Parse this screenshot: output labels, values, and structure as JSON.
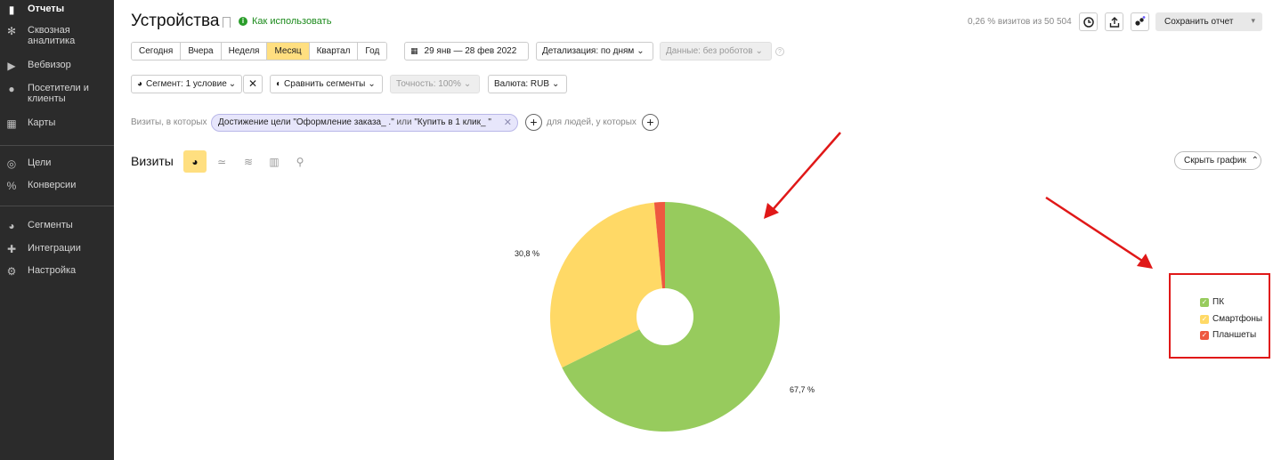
{
  "sidebar": {
    "items": [
      {
        "label": "Отчеты",
        "icon": "bar-chart-icon",
        "active": true
      },
      {
        "label": "Сквозная аналитика",
        "icon": "asterisk-icon"
      },
      {
        "label": "Вебвизор",
        "icon": "play-icon"
      },
      {
        "label": "Посетители и клиенты",
        "icon": "person-icon"
      },
      {
        "label": "Карты",
        "icon": "map-grid-icon"
      },
      {
        "label": "Цели",
        "icon": "target-icon"
      },
      {
        "label": "Конверсии",
        "icon": "percent-icon"
      },
      {
        "label": "Сегменты",
        "icon": "pie-icon"
      },
      {
        "label": "Интеграции",
        "icon": "puzzle-icon"
      },
      {
        "label": "Настройка",
        "icon": "gear-icon"
      }
    ]
  },
  "header": {
    "title": "Устройства",
    "howto": "Как использовать",
    "visits_share": "0,26 % визитов из 50 504",
    "save_report": "Сохранить отчет"
  },
  "periods": {
    "items": [
      "Сегодня",
      "Вчера",
      "Неделя",
      "Месяц",
      "Квартал",
      "Год"
    ],
    "selected": "Месяц",
    "date_range": "29 янв — 28 фев 2022",
    "detail": "Детализация: по дням",
    "data_filter": "Данные: без роботов"
  },
  "segment_row": {
    "segment": "Сегмент: 1 условие",
    "compare": "Сравнить сегменты",
    "accuracy": "Точность: 100%",
    "currency": "Валюта: RUB"
  },
  "filter": {
    "prefix": "Визиты, в которых",
    "chip_part1": "Достижение цели \"Оформление заказа_   .\"",
    "chip_or": " или ",
    "chip_part2": "\"Купить в 1 клик_     \"",
    "suffix": "для людей, у которых"
  },
  "chart_header": {
    "title": "Визиты",
    "hide": "Скрыть график"
  },
  "colors": {
    "pc": "#97cb5d",
    "smartphones": "#ffd966",
    "tablets": "#ee5840",
    "selected": "#ffdf80",
    "annotation": "#e01818"
  },
  "chart_data": {
    "type": "pie",
    "donut": true,
    "categories": [
      "ПК",
      "Смартфоны",
      "Планшеты"
    ],
    "values": [
      67.7,
      30.8,
      1.5
    ],
    "data_labels": [
      "67,7 %",
      "30,8 %",
      ""
    ],
    "legend_position": "right"
  }
}
